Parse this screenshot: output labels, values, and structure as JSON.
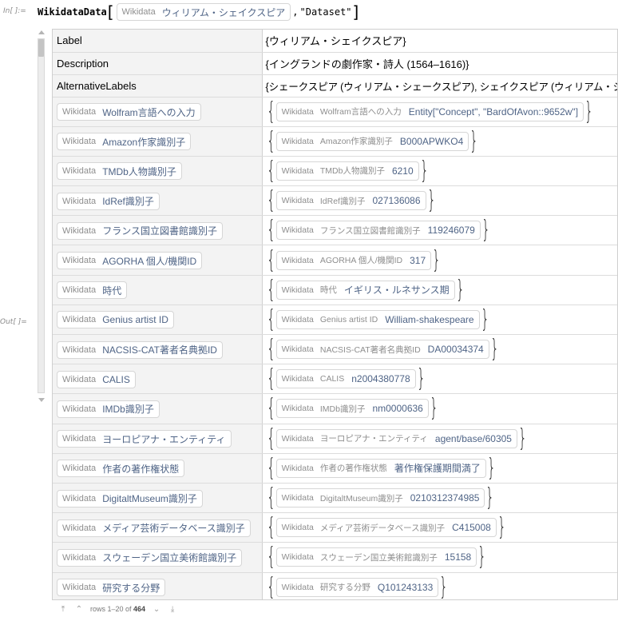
{
  "cell": {
    "in_label": "In[ ]:=",
    "out_label": "Out[ ]=",
    "function": "WikidataData",
    "arg_source": "Wikidata",
    "arg_entity": "ウィリアム・シェイクスピア",
    "arg_string": "\"Dataset\""
  },
  "dataset": {
    "plain_rows": [
      {
        "key": "Label",
        "value": "{ウィリアム・シェイクスピア}"
      },
      {
        "key": "Description",
        "value": "{イングランドの劇作家・詩人 (1564–1616)}"
      },
      {
        "key": "AlternativeLabels",
        "value": "{シェークスピア (ウィリアム・シェークスピア), シェイクスピア (ウィリアム・シェイクスピア)}"
      }
    ],
    "property_rows": [
      {
        "src": "Wikidata",
        "prop": "Wolfram言語への入力",
        "value": "Entity[\"Concept\", \"BardOfAvon::9652w\"]"
      },
      {
        "src": "Wikidata",
        "prop": "Amazon作家識別子",
        "value": "B000APWKO4"
      },
      {
        "src": "Wikidata",
        "prop": "TMDb人物識別子",
        "value": "6210"
      },
      {
        "src": "Wikidata",
        "prop": "IdRef識別子",
        "value": "027136086"
      },
      {
        "src": "Wikidata",
        "prop": "フランス国立図書館識別子",
        "value": "119246079"
      },
      {
        "src": "Wikidata",
        "prop": "AGORHA 個人/機関ID",
        "value": "317"
      },
      {
        "src": "Wikidata",
        "prop": "時代",
        "value": "イギリス・ルネサンス期"
      },
      {
        "src": "Wikidata",
        "prop": "Genius artist ID",
        "value": "William-shakespeare"
      },
      {
        "src": "Wikidata",
        "prop": "NACSIS-CAT著者名典拠ID",
        "value": "DA00034374"
      },
      {
        "src": "Wikidata",
        "prop": "CALIS",
        "value": "n2004380778"
      },
      {
        "src": "Wikidata",
        "prop": "IMDb識別子",
        "value": "nm0000636"
      },
      {
        "src": "Wikidata",
        "prop": "ヨーロピアナ・エンティティ",
        "value": "agent/base/60305"
      },
      {
        "src": "Wikidata",
        "prop": "作者の著作権状態",
        "value": "著作権保護期間満了"
      },
      {
        "src": "Wikidata",
        "prop": "DigitaltMuseum識別子",
        "value": "0210312374985"
      },
      {
        "src": "Wikidata",
        "prop": "メディア芸術データベース識別子",
        "value": "C415008"
      },
      {
        "src": "Wikidata",
        "prop": "スウェーデン国立美術館識別子",
        "value": "15158"
      },
      {
        "src": "Wikidata",
        "prop": "研究する分野",
        "value": "Q101243133"
      }
    ]
  },
  "footer": {
    "rows_prefix": "rows 1–20 of",
    "rows_total": "464"
  },
  "colors": {
    "pill_text": "#4f6486",
    "key_bg": "#f3f3f3"
  }
}
